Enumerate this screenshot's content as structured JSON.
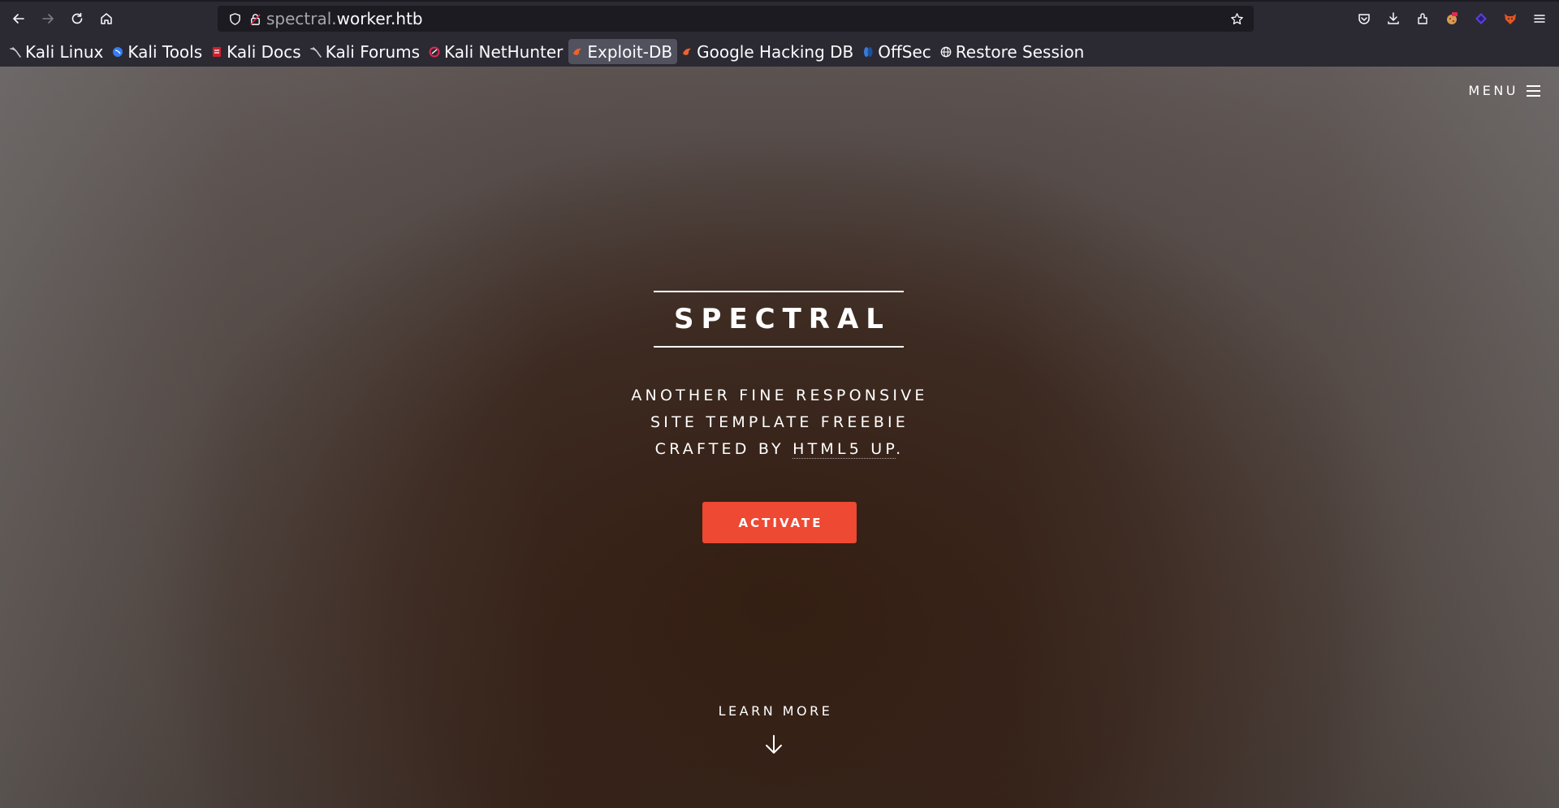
{
  "browser": {
    "url_prefix": "spectral.",
    "url_domain": "worker.htb",
    "toolbar_icons": [
      "back-icon",
      "forward-icon",
      "reload-icon",
      "home-icon",
      "shield-icon",
      "lock-icon",
      "star-icon",
      "pocket-icon",
      "download-icon",
      "extensions-icon",
      "cookie-extension-icon",
      "purple-extension-icon",
      "fox-extension-icon",
      "hamburger-menu-icon"
    ],
    "bookmarks": [
      {
        "label": "Kali Linux",
        "icon": "kali-dragon-icon"
      },
      {
        "label": "Kali Tools",
        "icon": "kali-tools-icon"
      },
      {
        "label": "Kali Docs",
        "icon": "kali-docs-icon"
      },
      {
        "label": "Kali Forums",
        "icon": "kali-dragon-icon"
      },
      {
        "label": "Kali NetHunter",
        "icon": "nethunter-icon"
      },
      {
        "label": "Exploit-DB",
        "icon": "exploitdb-icon"
      },
      {
        "label": "Google Hacking DB",
        "icon": "exploitdb-icon"
      },
      {
        "label": "OffSec",
        "icon": "offsec-icon"
      },
      {
        "label": "Restore Session",
        "icon": "globe-icon"
      }
    ]
  },
  "page": {
    "menu_label": "MENU",
    "title": "SPECTRAL",
    "subtitle_line1": "ANOTHER FINE RESPONSIVE",
    "subtitle_line2": "SITE TEMPLATE FREEBIE",
    "subtitle_line3_prefix": "CRAFTED BY ",
    "subtitle_link": "HTML5 UP",
    "subtitle_line3_suffix": ".",
    "activate_label": "ACTIVATE",
    "learn_more_label": "LEARN MORE",
    "accent_color": "#ed4933"
  }
}
